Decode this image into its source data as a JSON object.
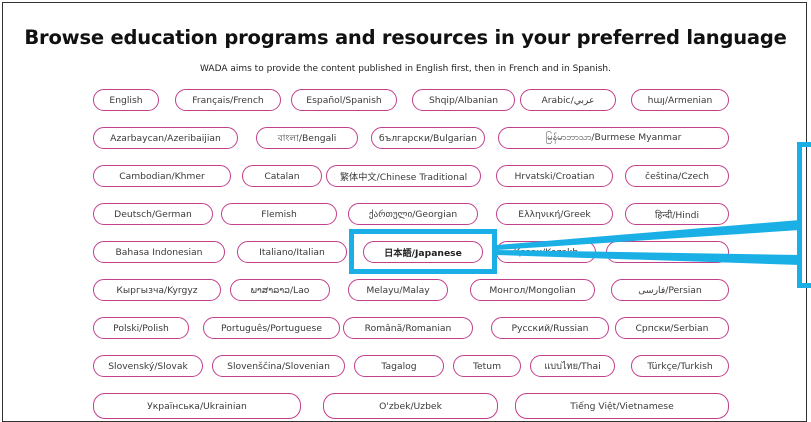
{
  "header": {
    "title": "Browse education programs and resources in your preferred language",
    "subtitle": "WADA aims to provide the content published in English first, then in French and in Spanish."
  },
  "languages": {
    "english": "English",
    "french": "Français/French",
    "spanish": "Español/Spanish",
    "albanian": "Shqip/Albanian",
    "arabic": "Arabic/عربي",
    "armenian": "հայ/Armenian",
    "azerbaijani": "Azarbaycan/Azeribaijian",
    "bengali": "বাংলা/Bengali",
    "bulgarian": "български/Bulgarian",
    "burmese": "မြန်မာဘာသာ/Burmese Myanmar",
    "cambodian": "Cambodian/Khmer",
    "catalan": "Catalan",
    "chinese_traditional": "繁体中文/Chinese Traditional",
    "croatian": "Hrvatski/Croatian",
    "czech": "čeština/Czech",
    "german": "Deutsch/German",
    "flemish": "Flemish",
    "georgian": "ქართული/Georgian",
    "greek": "Ελληνική/Greek",
    "hindi": "हिन्दी/Hindi",
    "indonesian": "Bahasa Indonesian",
    "italian": "Italiano/Italian",
    "japanese": "日本語/Japanese",
    "kazakh": "Қазақ/Kazakh",
    "kyrgyz": "Кыргызча/Kyrgyz",
    "lao": "ພາສາລາວ/Lao",
    "malay": "Melayu/Malay",
    "mongolian": "Монгол/Mongolian",
    "persian": "فارسی/Persian",
    "polish": "Polski/Polish",
    "portuguese": "Português/Portuguese",
    "romanian": "Română/Romanian",
    "russian": "Русский/Russian",
    "serbian": "Српски/Serbian",
    "slovak": "Slovenský/Slovak",
    "slovenian": "Slovenščina/Slovenian",
    "tagalog": "Tagalog",
    "tetum": "Tetum",
    "thai": "แบบไทย/Thai",
    "turkish": "Türkçe/Turkish",
    "ukrainian": "Українська/Ukrainian",
    "uzbek": "O'zbek/Uzbek",
    "vietnamese": "Tiếng Việt/Vietnamese"
  },
  "annotation": {
    "highlight_color": "#1ab0e6",
    "highlighted_item": "日本語/Japanese"
  },
  "theme": {
    "pill_border": "#c23f8c",
    "text": "#3a3a3a"
  }
}
